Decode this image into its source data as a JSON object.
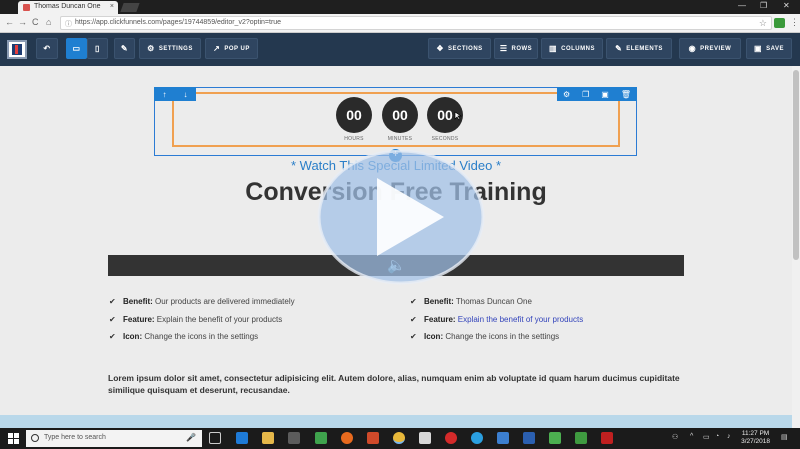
{
  "browser": {
    "tab_title": "Thomas Duncan One",
    "tab_close": "×",
    "url": "https://app.clickfunnels.com/pages/19744859/editor_v2?optin=true",
    "back": "←",
    "forward": "→",
    "reload": "C",
    "home": "⌂",
    "lock": "ⓘ",
    "star": "☆",
    "menu": "⋮",
    "minimize": "—",
    "maximize": "❐",
    "close": "✕"
  },
  "toolbar": {
    "undo": "↶",
    "desktop": "▭",
    "mobile": "▯",
    "wand": "✎",
    "settings_label": "SETTINGS",
    "popup_label": "POP UP",
    "sections_label": "SECTIONS",
    "rows_label": "ROWS",
    "columns_label": "COLUMNS",
    "elements_label": "ELEMENTS",
    "preview_label": "PREVIEW",
    "save_label": "SAVE",
    "icons": {
      "settings": "⚙",
      "popup": "↗",
      "sections": "❖",
      "rows": "☰",
      "columns": "▥",
      "elements": "✎",
      "preview": "◉",
      "save": "▣"
    }
  },
  "handles": {
    "up": "↑",
    "down": "↓",
    "gear": "⚙",
    "copy": "❐",
    "save": "▣",
    "trash": "🗑",
    "add": "+"
  },
  "countdown": {
    "hours": "00",
    "minutes": "00",
    "seconds": "00",
    "hours_label": "HOURS",
    "minutes_label": "MINUTES",
    "seconds_label": "SECONDS"
  },
  "page": {
    "subheadline": "* Watch This Special Limited Video *",
    "headline": "Conversion Free Training",
    "check": "✔",
    "speaker": "🔈",
    "bullets_left": [
      {
        "label": "Benefit:",
        "text": " Our products are delivered immediately"
      },
      {
        "label": "Feature:",
        "text": " Explain the benefit of your products"
      },
      {
        "label": "Icon:",
        "text": " Change the icons in the settings"
      }
    ],
    "bullets_right": [
      {
        "label": "Benefit:",
        "text": " Thomas Duncan One"
      },
      {
        "label": "Feature:",
        "text": " Explain the benefit of your products"
      },
      {
        "label": "Icon:",
        "text": " Change the icons in the settings"
      }
    ],
    "lorem": "Lorem ipsum dolor sit amet, consectetur adipisicing elit. Autem dolore, alias, numquam enim ab voluptate id quam harum ducimus cupiditate similique quisquam et deserunt, recusandae."
  },
  "taskbar": {
    "search_placeholder": "Type here to search",
    "mic": "🎤",
    "time": "11:27 PM",
    "date": "3/27/2018"
  },
  "colors": {
    "toolbar_bg": "#24384f",
    "accent_blue": "#1f7fd1",
    "orange_border": "#f0a050",
    "play_overlay": "#9fbfe6",
    "headline_blue": "#2a7ec8"
  }
}
